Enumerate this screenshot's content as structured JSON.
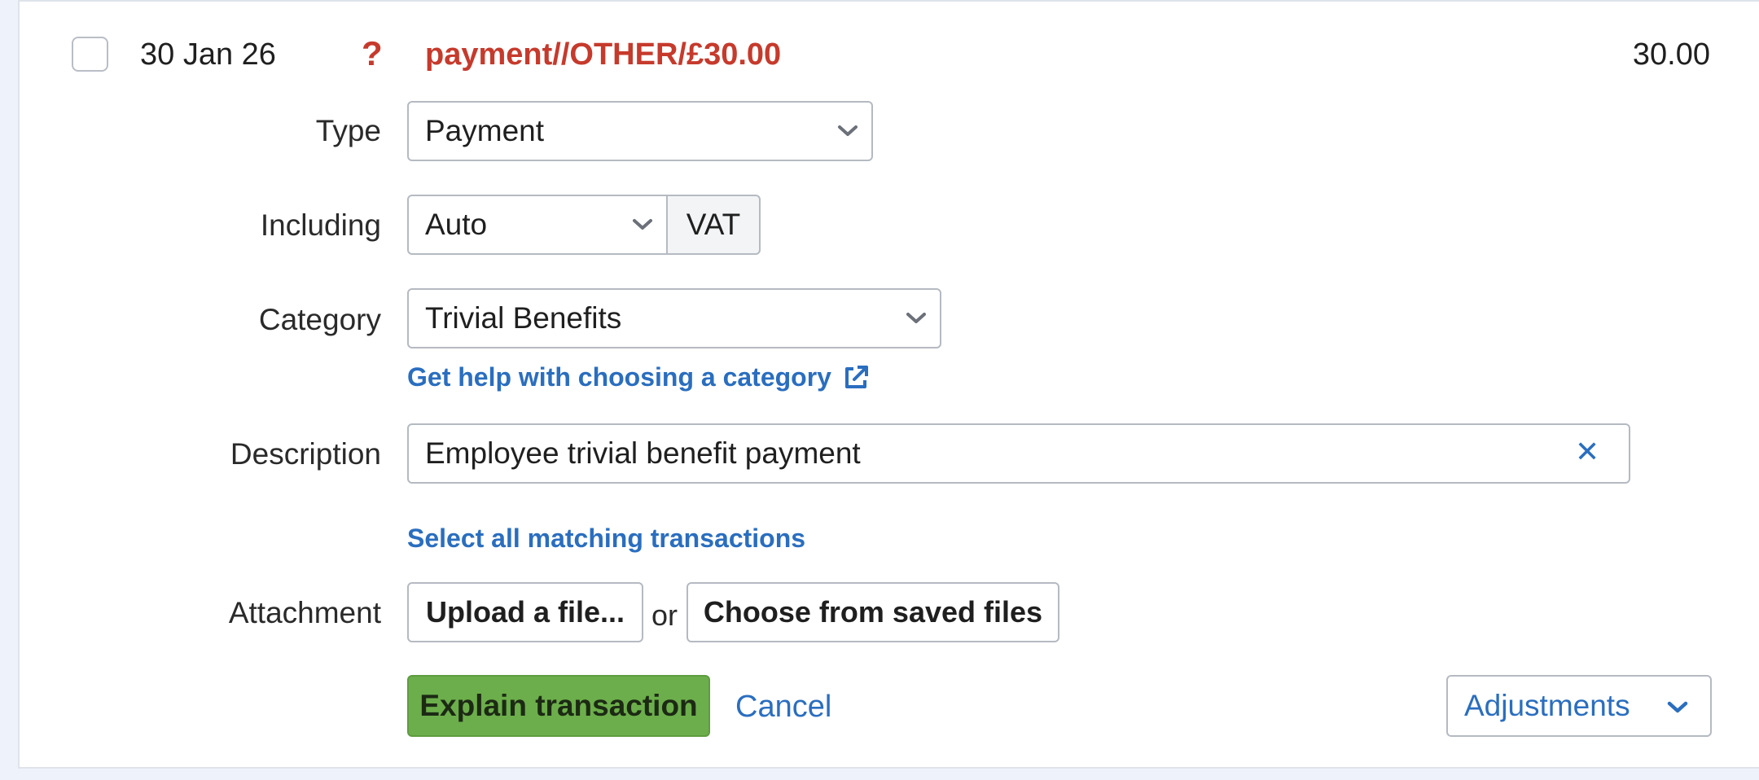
{
  "transaction": {
    "date": "30 Jan 26",
    "status_glyph": "?",
    "title": "payment//OTHER/£30.00",
    "amount": "30.00"
  },
  "form": {
    "type": {
      "label": "Type",
      "value": "Payment"
    },
    "including": {
      "label": "Including",
      "value": "Auto",
      "addon": "VAT"
    },
    "category": {
      "label": "Category",
      "value": "Trivial Benefits",
      "help_link": "Get help with choosing a category"
    },
    "description": {
      "label": "Description",
      "value": "Employee trivial benefit payment",
      "clear_glyph": "✕"
    },
    "select_matching_link": "Select all matching transactions",
    "attachment": {
      "label": "Attachment",
      "upload_label": "Upload a file...",
      "or_text": "or",
      "choose_label": "Choose from saved files"
    },
    "actions": {
      "explain_label": "Explain transaction",
      "cancel_label": "Cancel",
      "adjustments_label": "Adjustments"
    }
  },
  "colors": {
    "accent_blue": "#2a6ebf",
    "alert_red": "#c63a2c",
    "primary_green": "#6cae4b",
    "page_bg": "#eef3fb"
  },
  "icons": {
    "select_chevron": "chevron-down-icon",
    "external_link": "external-link-icon",
    "clear": "close-icon"
  }
}
